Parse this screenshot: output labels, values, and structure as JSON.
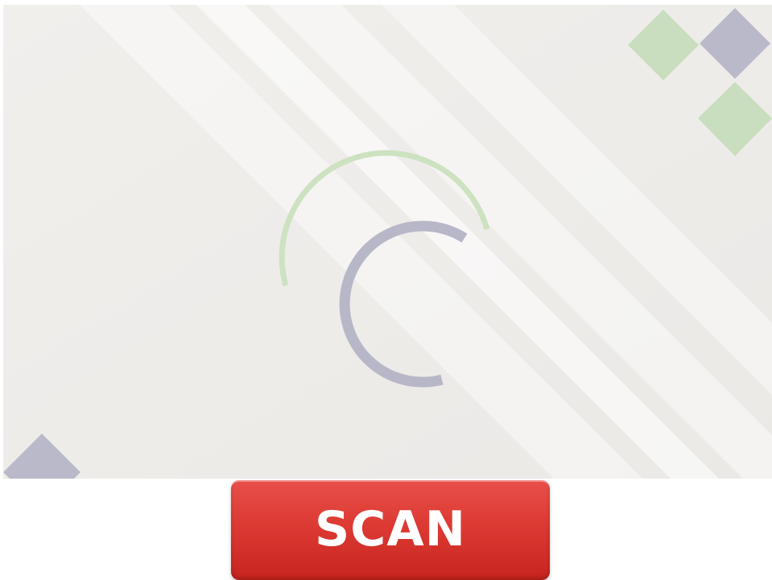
{
  "scan_button": {
    "label": "SCAN"
  },
  "theme": {
    "background": "#efedea",
    "stripe": "#ffffff",
    "diamond_green": "#c8dcbd",
    "diamond_slate": "#b8b8c9",
    "spinner_green": "#cfe3c2",
    "spinner_slate": "#b9b8c8",
    "button_red": "#d9352f",
    "button_text": "#ffffff"
  },
  "icons": {
    "loading": "loading-spinner-icon"
  }
}
